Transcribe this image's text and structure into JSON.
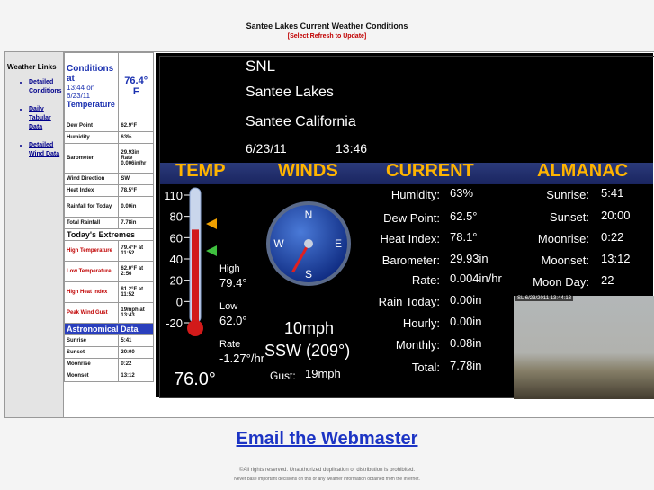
{
  "header": {
    "title": "Santee Lakes Current Weather Conditions",
    "refresh": "[Select Refresh to Update]"
  },
  "sidebar": {
    "heading": "Weather Links",
    "links": [
      {
        "label": "Detailed Conditions"
      },
      {
        "label": "Daily Tabular Data"
      },
      {
        "label": "Detailed Wind Data"
      }
    ]
  },
  "conditions": {
    "label_prefix": "Conditions at",
    "time": "13:44 on 6/23/11",
    "temp_label": "Temperature",
    "temp": "76.4° F",
    "rows": [
      {
        "label": "Dew Point",
        "value": "62.9°F"
      },
      {
        "label": "Humidity",
        "value": "63%"
      },
      {
        "label": "Barometer",
        "value": "29.93in Rate 0.006in/hr"
      },
      {
        "label": "Wind Direction",
        "value": "SW"
      },
      {
        "label": "Heat Index",
        "value": "78.5°F"
      },
      {
        "label": "Rainfall for Today",
        "value": "0.00in"
      },
      {
        "label": "Total Rainfall",
        "value": "7.78in"
      }
    ],
    "extremes_title": "Today's Extremes",
    "extremes": [
      {
        "label": "High Temperature",
        "value": "79.4°F at 11:52"
      },
      {
        "label": "Low Temperature",
        "value": "62.0°F at 2:56"
      },
      {
        "label": "High Heat Index",
        "value": "81.2°F at 11:52"
      },
      {
        "label": "Peak Wind Gust",
        "value": "19mph at 13:43"
      }
    ],
    "astro_title": "Astronomical Data",
    "astro": [
      {
        "label": "Sunrise",
        "value": "5:41"
      },
      {
        "label": "Sunset",
        "value": "20:00"
      },
      {
        "label": "Moonrise",
        "value": "0:22"
      },
      {
        "label": "Moonset",
        "value": "13:12"
      }
    ]
  },
  "panel": {
    "station": "SNL",
    "name": "Santee Lakes",
    "location": "Santee California",
    "date": "6/23/11",
    "time": "13:46",
    "bands": {
      "temp": "TEMP",
      "winds": "WINDS",
      "current": "CURRENT",
      "almanac": "ALMANAC"
    },
    "thermo": {
      "ticks": [
        "110",
        "80",
        "60",
        "40",
        "20",
        "0",
        "-20"
      ],
      "high_label": "High",
      "high": "79.4°",
      "low_label": "Low",
      "low": "62.0°",
      "rate_label": "Rate",
      "rate": "-1.27°/hr",
      "current": "76.0°",
      "fill_fraction": 0.7
    },
    "wind": {
      "compass": {
        "n": "N",
        "e": "E",
        "s": "S",
        "w": "W"
      },
      "speed": "10mph",
      "direction": "SSW (209°)",
      "gust_label": "Gust:",
      "gust": "19mph",
      "heading_deg": 209
    },
    "current": [
      {
        "label": "Humidity:",
        "value": "63%"
      },
      {
        "label": "Dew Point:",
        "value": "62.5°"
      },
      {
        "label": "Heat Index:",
        "value": "78.1°"
      },
      {
        "label": "Barometer:",
        "value": "29.93in"
      },
      {
        "label": "Rate:",
        "value": "0.004in/hr"
      },
      {
        "label": "Rain Today:",
        "value": "0.00in"
      },
      {
        "label": "Hourly:",
        "value": "0.00in"
      },
      {
        "label": "Monthly:",
        "value": "0.08in"
      },
      {
        "label": "Total:",
        "value": "7.78in"
      }
    ],
    "almanac": [
      {
        "label": "Sunrise:",
        "value": "5:41"
      },
      {
        "label": "Sunset:",
        "value": "20:00"
      },
      {
        "label": "Moonrise:",
        "value": "0:22"
      },
      {
        "label": "Moonset:",
        "value": "13:12"
      },
      {
        "label": "Moon Day:",
        "value": "22"
      }
    ],
    "webcam_stamp": "SL 6/23/2011 13:44:13"
  },
  "footer": {
    "email_link": "Email the Webmaster",
    "copyright": "©All rights reserved. Unauthorized duplication or distribution is prohibited.",
    "disclaimer": "Never base important decisions on this or any weather information obtained from the Internet."
  }
}
